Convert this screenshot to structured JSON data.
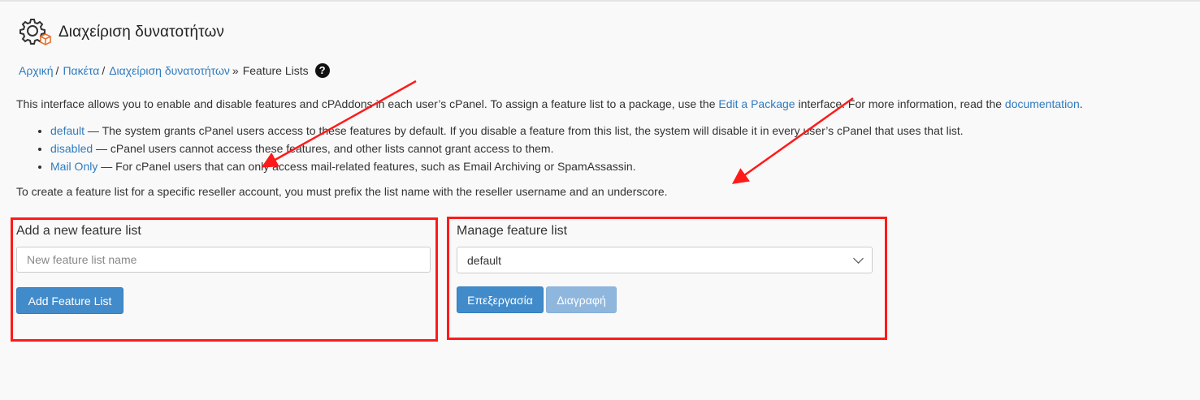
{
  "page": {
    "title": "Διαχείριση δυνατοτήτων"
  },
  "breadcrumb": {
    "items": [
      {
        "label": "Αρχική",
        "sep": "/"
      },
      {
        "label": "Πακέτα",
        "sep": "/"
      },
      {
        "label": "Διαχείριση δυνατοτήτων",
        "sep": "»"
      }
    ],
    "current": "Feature Lists",
    "help_glyph": "?"
  },
  "intro": {
    "text_before": "This interface allows you to enable and disable features and cPAddons in each user’s cPanel. To assign a feature list to a package, use the ",
    "link1": "Edit a Package",
    "text_middle": " interface. For more information, read the ",
    "link2": "documentation",
    "text_after": "."
  },
  "feature_types": [
    {
      "name": "default",
      "desc": " — The system grants cPanel users access to these features by default. If you disable a feature from this list, the system will disable it in every user’s cPanel that uses that list."
    },
    {
      "name": "disabled",
      "desc": " — cPanel users cannot access these features, and other lists cannot grant access to them."
    },
    {
      "name": "Mail Only",
      "desc": " — For cPanel users that can only access mail-related features, such as Email Archiving or SpamAssassin."
    }
  ],
  "reseller_note": "To create a feature list for a specific reseller account, you must prefix the list name with the reseller username and an underscore.",
  "add_panel": {
    "title": "Add a new feature list",
    "input_placeholder": "New feature list name",
    "input_value": "",
    "button_label": "Add Feature List"
  },
  "manage_panel": {
    "title": "Manage feature list",
    "selected_option": "default",
    "edit_label": "Επεξεργασία",
    "delete_label": "Διαγραφή"
  },
  "colors": {
    "link": "#2f7bbf",
    "primary_button": "#428bca",
    "disabled_button": "#8fb7de",
    "annotation_red": "#ff1a1a"
  },
  "icons": [
    "feature-manager-gear-icon",
    "help-icon",
    "chevron-down-icon"
  ]
}
